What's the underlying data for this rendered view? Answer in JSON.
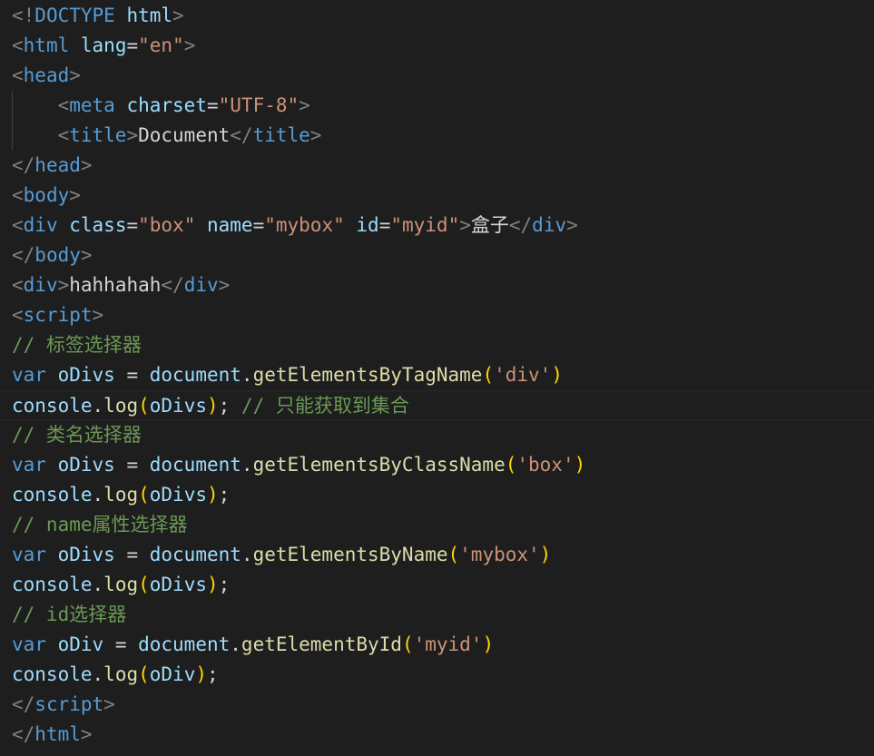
{
  "editor": {
    "theme_colors": {
      "background": "#1e1e1e",
      "tag": "#569cd6",
      "attribute": "#9cdcfe",
      "string": "#ce9178",
      "function": "#dcdcaa",
      "comment": "#6a9955",
      "bracket": "#ffd700",
      "punctuation": "#808080",
      "text": "#d4d4d4"
    },
    "lines": [
      [
        {
          "c": "t",
          "v": "<!"
        },
        {
          "c": "doc",
          "v": "DOCTYPE"
        },
        {
          "c": "txt",
          "v": " "
        },
        {
          "c": "attr",
          "v": "html"
        },
        {
          "c": "t",
          "v": ">"
        }
      ],
      [
        {
          "c": "t",
          "v": "<"
        },
        {
          "c": "tag",
          "v": "html"
        },
        {
          "c": "txt",
          "v": " "
        },
        {
          "c": "attr",
          "v": "lang"
        },
        {
          "c": "txt",
          "v": "="
        },
        {
          "c": "str",
          "v": "\"en\""
        },
        {
          "c": "t",
          "v": ">"
        }
      ],
      [
        {
          "c": "t",
          "v": "<"
        },
        {
          "c": "tag",
          "v": "head"
        },
        {
          "c": "t",
          "v": ">"
        }
      ],
      [
        {
          "c": "txt",
          "v": "    "
        },
        {
          "c": "t",
          "v": "<"
        },
        {
          "c": "tag",
          "v": "meta"
        },
        {
          "c": "txt",
          "v": " "
        },
        {
          "c": "attr",
          "v": "charset"
        },
        {
          "c": "txt",
          "v": "="
        },
        {
          "c": "str",
          "v": "\"UTF-8\""
        },
        {
          "c": "t",
          "v": ">"
        }
      ],
      [
        {
          "c": "txt",
          "v": "    "
        },
        {
          "c": "t",
          "v": "<"
        },
        {
          "c": "tag",
          "v": "title"
        },
        {
          "c": "t",
          "v": ">"
        },
        {
          "c": "txt",
          "v": "Document"
        },
        {
          "c": "t",
          "v": "</"
        },
        {
          "c": "tag",
          "v": "title"
        },
        {
          "c": "t",
          "v": ">"
        }
      ],
      [
        {
          "c": "t",
          "v": "</"
        },
        {
          "c": "tag",
          "v": "head"
        },
        {
          "c": "t",
          "v": ">"
        }
      ],
      [
        {
          "c": "t",
          "v": "<"
        },
        {
          "c": "tag",
          "v": "body"
        },
        {
          "c": "t",
          "v": ">"
        }
      ],
      [
        {
          "c": "t",
          "v": "<"
        },
        {
          "c": "tag",
          "v": "div"
        },
        {
          "c": "txt",
          "v": " "
        },
        {
          "c": "attr",
          "v": "class"
        },
        {
          "c": "txt",
          "v": "="
        },
        {
          "c": "str",
          "v": "\"box\""
        },
        {
          "c": "txt",
          "v": " "
        },
        {
          "c": "attr",
          "v": "name"
        },
        {
          "c": "txt",
          "v": "="
        },
        {
          "c": "str",
          "v": "\"mybox\""
        },
        {
          "c": "txt",
          "v": " "
        },
        {
          "c": "attr",
          "v": "id"
        },
        {
          "c": "txt",
          "v": "="
        },
        {
          "c": "str",
          "v": "\"myid\""
        },
        {
          "c": "t",
          "v": ">"
        },
        {
          "c": "txt",
          "v": "盒子"
        },
        {
          "c": "t",
          "v": "</"
        },
        {
          "c": "tag",
          "v": "div"
        },
        {
          "c": "t",
          "v": ">"
        }
      ],
      [
        {
          "c": "t",
          "v": "</"
        },
        {
          "c": "tag",
          "v": "body"
        },
        {
          "c": "t",
          "v": ">"
        }
      ],
      [
        {
          "c": "t",
          "v": "<"
        },
        {
          "c": "tag",
          "v": "div"
        },
        {
          "c": "t",
          "v": ">"
        },
        {
          "c": "txt",
          "v": "hahhahah"
        },
        {
          "c": "t",
          "v": "</"
        },
        {
          "c": "tag",
          "v": "div"
        },
        {
          "c": "t",
          "v": ">"
        }
      ],
      [
        {
          "c": "t",
          "v": "<"
        },
        {
          "c": "tag",
          "v": "script"
        },
        {
          "c": "t",
          "v": ">"
        }
      ],
      [
        {
          "c": "cm",
          "v": "// 标签选择器"
        }
      ],
      [
        {
          "c": "kw",
          "v": "var"
        },
        {
          "c": "txt",
          "v": " "
        },
        {
          "c": "var",
          "v": "oDivs"
        },
        {
          "c": "txt",
          "v": " = "
        },
        {
          "c": "var",
          "v": "document"
        },
        {
          "c": "txt",
          "v": "."
        },
        {
          "c": "fn",
          "v": "getElementsByTagName"
        },
        {
          "c": "br",
          "v": "("
        },
        {
          "c": "str",
          "v": "'div'"
        },
        {
          "c": "br",
          "v": ")"
        }
      ],
      [
        {
          "c": "var",
          "v": "console"
        },
        {
          "c": "txt",
          "v": "."
        },
        {
          "c": "fn",
          "v": "log"
        },
        {
          "c": "br",
          "v": "("
        },
        {
          "c": "var",
          "v": "oDivs"
        },
        {
          "c": "br",
          "v": ")"
        },
        {
          "c": "txt",
          "v": "; "
        },
        {
          "c": "cm",
          "v": "// 只能获取到集合"
        }
      ],
      [
        {
          "c": "cm",
          "v": "// 类名选择器"
        }
      ],
      [
        {
          "c": "kw",
          "v": "var"
        },
        {
          "c": "txt",
          "v": " "
        },
        {
          "c": "var",
          "v": "oDivs"
        },
        {
          "c": "txt",
          "v": " = "
        },
        {
          "c": "var",
          "v": "document"
        },
        {
          "c": "txt",
          "v": "."
        },
        {
          "c": "fn",
          "v": "getElementsByClassName"
        },
        {
          "c": "br",
          "v": "("
        },
        {
          "c": "str",
          "v": "'box'"
        },
        {
          "c": "br",
          "v": ")"
        }
      ],
      [
        {
          "c": "var",
          "v": "console"
        },
        {
          "c": "txt",
          "v": "."
        },
        {
          "c": "fn",
          "v": "log"
        },
        {
          "c": "br",
          "v": "("
        },
        {
          "c": "var",
          "v": "oDivs"
        },
        {
          "c": "br",
          "v": ")"
        },
        {
          "c": "txt",
          "v": ";"
        }
      ],
      [
        {
          "c": "cm",
          "v": "// name属性选择器"
        }
      ],
      [
        {
          "c": "kw",
          "v": "var"
        },
        {
          "c": "txt",
          "v": " "
        },
        {
          "c": "var",
          "v": "oDivs"
        },
        {
          "c": "txt",
          "v": " = "
        },
        {
          "c": "var",
          "v": "document"
        },
        {
          "c": "txt",
          "v": "."
        },
        {
          "c": "fn",
          "v": "getElementsByName"
        },
        {
          "c": "br",
          "v": "("
        },
        {
          "c": "str",
          "v": "'mybox'"
        },
        {
          "c": "br",
          "v": ")"
        }
      ],
      [
        {
          "c": "var",
          "v": "console"
        },
        {
          "c": "txt",
          "v": "."
        },
        {
          "c": "fn",
          "v": "log"
        },
        {
          "c": "br",
          "v": "("
        },
        {
          "c": "var",
          "v": "oDivs"
        },
        {
          "c": "br",
          "v": ")"
        },
        {
          "c": "txt",
          "v": ";"
        }
      ],
      [
        {
          "c": "cm",
          "v": "// id选择器"
        }
      ],
      [
        {
          "c": "kw",
          "v": "var"
        },
        {
          "c": "txt",
          "v": " "
        },
        {
          "c": "var",
          "v": "oDiv"
        },
        {
          "c": "txt",
          "v": " = "
        },
        {
          "c": "var",
          "v": "document"
        },
        {
          "c": "txt",
          "v": "."
        },
        {
          "c": "fn",
          "v": "getElementById"
        },
        {
          "c": "br",
          "v": "("
        },
        {
          "c": "str",
          "v": "'myid'"
        },
        {
          "c": "br",
          "v": ")"
        }
      ],
      [
        {
          "c": "var",
          "v": "console"
        },
        {
          "c": "txt",
          "v": "."
        },
        {
          "c": "fn",
          "v": "log"
        },
        {
          "c": "br",
          "v": "("
        },
        {
          "c": "var",
          "v": "oDiv"
        },
        {
          "c": "br",
          "v": ")"
        },
        {
          "c": "txt",
          "v": ";"
        }
      ],
      [
        {
          "c": "t",
          "v": "</"
        },
        {
          "c": "tag",
          "v": "script"
        },
        {
          "c": "t",
          "v": ">"
        }
      ],
      [
        {
          "c": "t",
          "v": "</"
        },
        {
          "c": "tag",
          "v": "html"
        },
        {
          "c": "t",
          "v": ">"
        }
      ]
    ],
    "active_line": 13
  }
}
